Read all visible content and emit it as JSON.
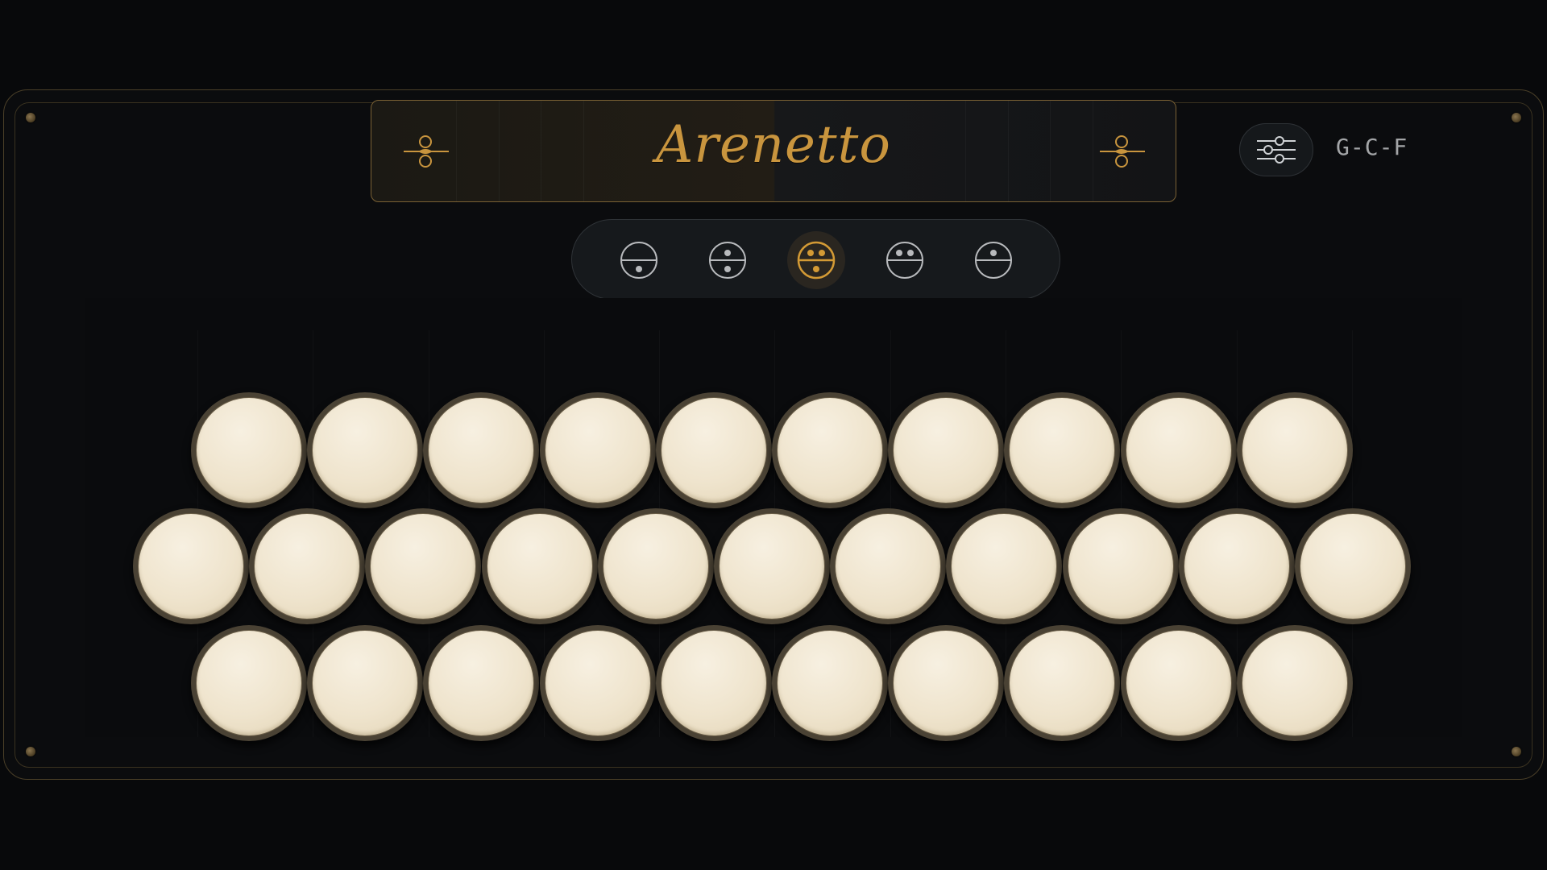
{
  "app": {
    "title": "Arenetto",
    "tuning": "G-C-F"
  },
  "colors": {
    "accent": "#c9953e",
    "background": "#08090b",
    "key": "#efe4cd"
  },
  "toolbar": {
    "settings_icon": "sliders-icon"
  },
  "registers": [
    {
      "icon": "register-low-icon",
      "active": false
    },
    {
      "icon": "register-mid-icon",
      "active": false
    },
    {
      "icon": "register-master-icon",
      "active": true
    },
    {
      "icon": "register-musette-icon",
      "active": false
    },
    {
      "icon": "register-bandoneon-icon",
      "active": false
    }
  ],
  "keyboard": {
    "rows": [
      10,
      11,
      10
    ]
  }
}
